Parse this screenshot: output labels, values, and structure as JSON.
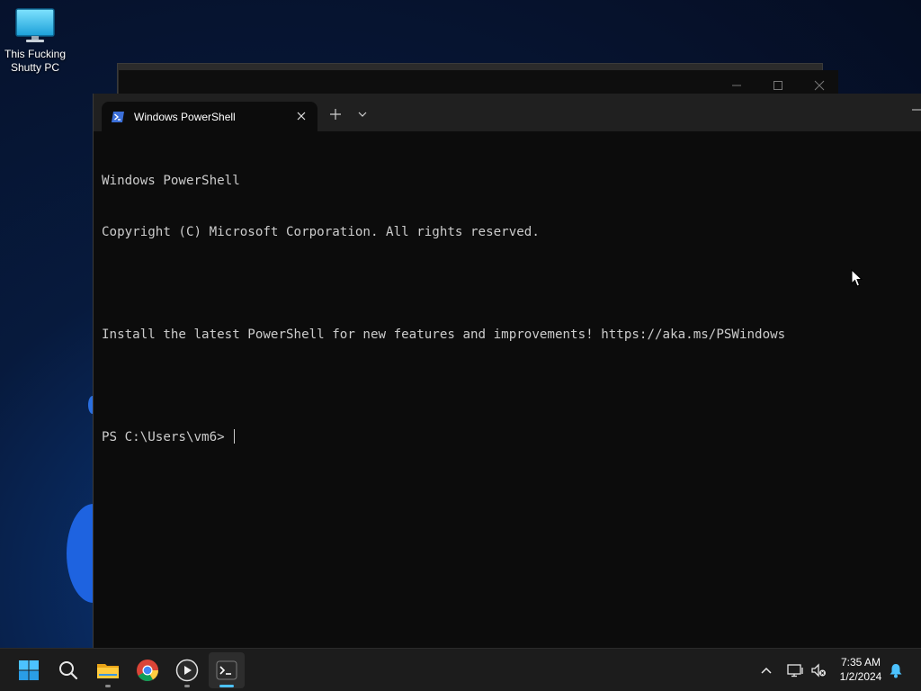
{
  "desktop": {
    "icons": [
      {
        "label_line1": "This Fucking",
        "label_line2": "Shutty PC",
        "icon": "monitor-icon"
      }
    ]
  },
  "terminal": {
    "tab_title": "Windows PowerShell",
    "tab_icon": "powershell-icon",
    "lines": [
      "Windows PowerShell",
      "Copyright (C) Microsoft Corporation. All rights reserved.",
      "",
      "Install the latest PowerShell for new features and improvements! https://aka.ms/PSWindows",
      ""
    ],
    "prompt": "PS C:\\Users\\vm6> "
  },
  "taskbar": {
    "items": [
      {
        "name": "start",
        "icon": "windows-logo-icon"
      },
      {
        "name": "search",
        "icon": "search-icon"
      },
      {
        "name": "file-explorer",
        "icon": "folder-icon"
      },
      {
        "name": "chrome",
        "icon": "chrome-icon"
      },
      {
        "name": "media-player",
        "icon": "play-icon"
      },
      {
        "name": "terminal",
        "icon": "terminal-icon",
        "active": true
      }
    ],
    "tray": {
      "icons": [
        "chevron-up-icon",
        "network-icon",
        "volume-muted-icon",
        "notification-bell-icon"
      ],
      "time": "7:35 AM",
      "date": "1/2/2024"
    }
  },
  "colors": {
    "terminal_bg": "#0c0c0c",
    "terminal_text": "#cccccc",
    "tabbar_bg": "#202020",
    "taskbar_bg": "#1c1c1c",
    "accent": "#4cc2ff"
  }
}
